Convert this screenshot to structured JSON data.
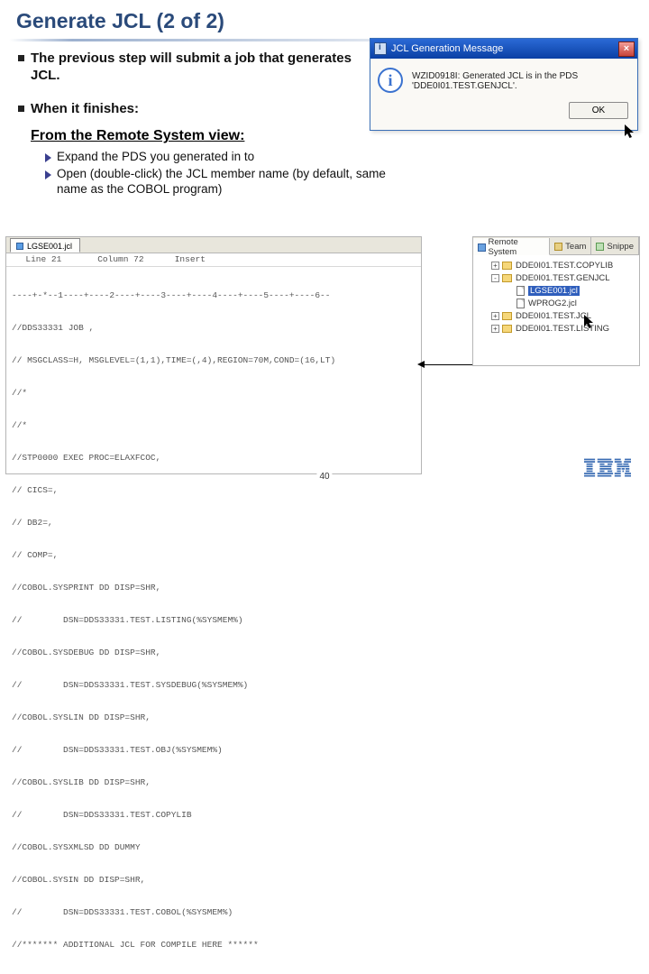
{
  "title": "Generate JCL (2 of 2)",
  "bullets": [
    "The previous step will submit a job that generates JCL.",
    "When it finishes:"
  ],
  "from_heading": "From the Remote System view:",
  "sub_bullets": [
    "Expand the PDS you generated in to",
    "Open (double-click) the JCL member name (by default, same name as the COBOL program)"
  ],
  "dialog": {
    "title": "JCL Generation Message",
    "message": "WZID0918I: Generated JCL is in the PDS 'DDE0I01.TEST.GENJCL'.",
    "ok_label": "OK",
    "close_glyph": "×"
  },
  "editor": {
    "tab_label": "LGSE001.jcl",
    "status_line": "  Line 21       Column 72      Insert",
    "ruler": "----+-*--1----+----2----+----3----+----4----+----5----+----6--",
    "lines": [
      "//DDS33331 JOB ,",
      "// MSGCLASS=H, MSGLEVEL=(1,1),TIME=(,4),REGION=70M,COND=(16,LT)",
      "//*",
      "//*",
      "//STP0000 EXEC PROC=ELAXFCOC,",
      "// CICS=,",
      "// DB2=,",
      "// COMP=,",
      "//COBOL.SYSPRINT DD DISP=SHR,",
      "//        DSN=DDS33331.TEST.LISTING(%SYSMEM%)",
      "//COBOL.SYSDEBUG DD DISP=SHR,",
      "//        DSN=DDS33331.TEST.SYSDEBUG(%SYSMEM%)",
      "//COBOL.SYSLIN DD DISP=SHR,",
      "//        DSN=DDS33331.TEST.OBJ(%SYSMEM%)",
      "//COBOL.SYSLIB DD DISP=SHR,",
      "//        DSN=DDS33331.TEST.COPYLIB",
      "//COBOL.SYSXMLSD DD DUMMY",
      "//COBOL.SYSIN DD DISP=SHR,",
      "//        DSN=DDS33331.TEST.COBOL(%SYSMEM%)",
      "//******* ADDITIONAL JCL FOR COMPILE HERE ******"
    ]
  },
  "remote": {
    "tabs": {
      "remote": "Remote System",
      "team": "Team",
      "snippets": "Snippe"
    },
    "nodes": [
      {
        "exp": "+",
        "ind": 1,
        "icon": "folder",
        "label": "DDE0I01.TEST.COPYLIB"
      },
      {
        "exp": "-",
        "ind": 1,
        "icon": "folder",
        "label": "DDE0I01.TEST.GENJCL"
      },
      {
        "exp": "",
        "ind": 2,
        "icon": "file",
        "label": "LGSE001.jcl",
        "sel": true
      },
      {
        "exp": "",
        "ind": 2,
        "icon": "file",
        "label": "WPROG2.jcl"
      },
      {
        "exp": "+",
        "ind": 1,
        "icon": "folder",
        "label": "DDE0I01.TEST.JCL"
      },
      {
        "exp": "+",
        "ind": 1,
        "icon": "folder",
        "label": "DDE0I01.TEST.LISTING"
      }
    ]
  },
  "page_number": "40",
  "logo_alt": "IBM"
}
